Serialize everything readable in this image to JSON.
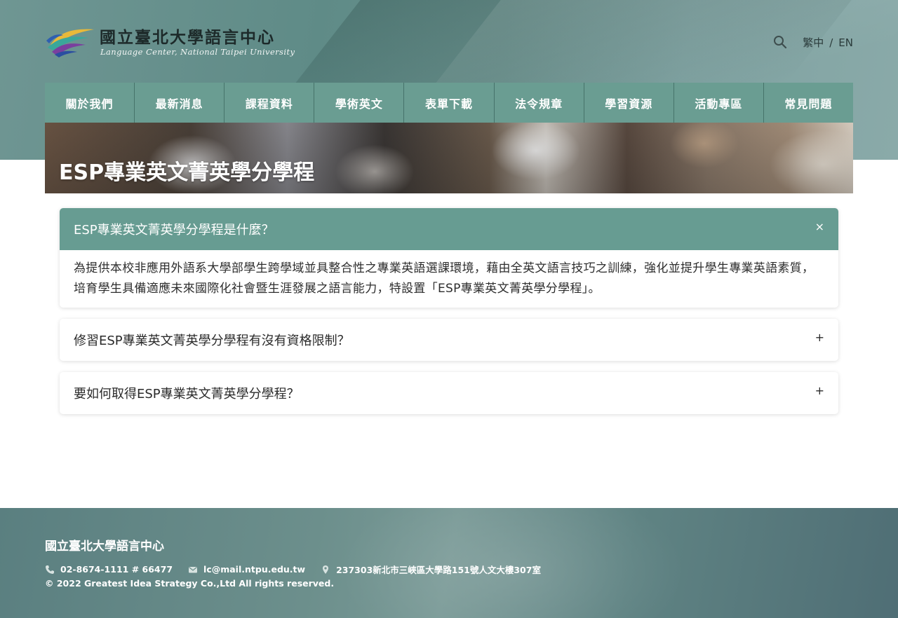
{
  "colors": {
    "accent": "#679c92",
    "nav_bg": "#6a9d92",
    "header_bg": "#6a918d",
    "footer_bg": "#6c8f8c"
  },
  "header": {
    "logo_cn": "國立臺北大學語言中心",
    "logo_en": "Language Center, National Taipei University",
    "search_icon": "search-icon",
    "lang_zh": "繁中",
    "lang_sep": "/",
    "lang_en": "EN"
  },
  "nav": {
    "items": [
      {
        "label": "關於我們"
      },
      {
        "label": "最新消息"
      },
      {
        "label": "課程資料"
      },
      {
        "label": "學術英文"
      },
      {
        "label": "表單下載"
      },
      {
        "label": "法令規章"
      },
      {
        "label": "學習資源"
      },
      {
        "label": "活動專區"
      },
      {
        "label": "常見問題"
      }
    ]
  },
  "banner": {
    "title": "ESP專業英文菁英學分學程"
  },
  "faq": {
    "items": [
      {
        "question": "ESP專業英文菁英學分學程是什麼？",
        "toggle": "×",
        "answer": "為提供本校非應用外語系大學部學生跨學域並具整合性之專業英語選課環境，藉由全英文語言技巧之訓練，強化並提升學生專業英語素質，培育學生具備適應未來國際化社會暨生涯發展之語言能力，特設置「ESP專業英文菁英學分學程」。"
      },
      {
        "question": "修習ESP專業英文菁英學分學程有沒有資格限制？",
        "toggle": "+"
      },
      {
        "question": "要如何取得ESP專業英文菁英學分學程？",
        "toggle": "+"
      }
    ]
  },
  "footer": {
    "title": "國立臺北大學語言中心",
    "phone": "02-8674-1111 # 66477",
    "email": "lc@mail.ntpu.edu.tw",
    "address": "237303新北市三峽區大學路151號人文大樓307室",
    "copyright": "© 2022 Greatest Idea Strategy Co.,Ltd All rights reserved."
  }
}
